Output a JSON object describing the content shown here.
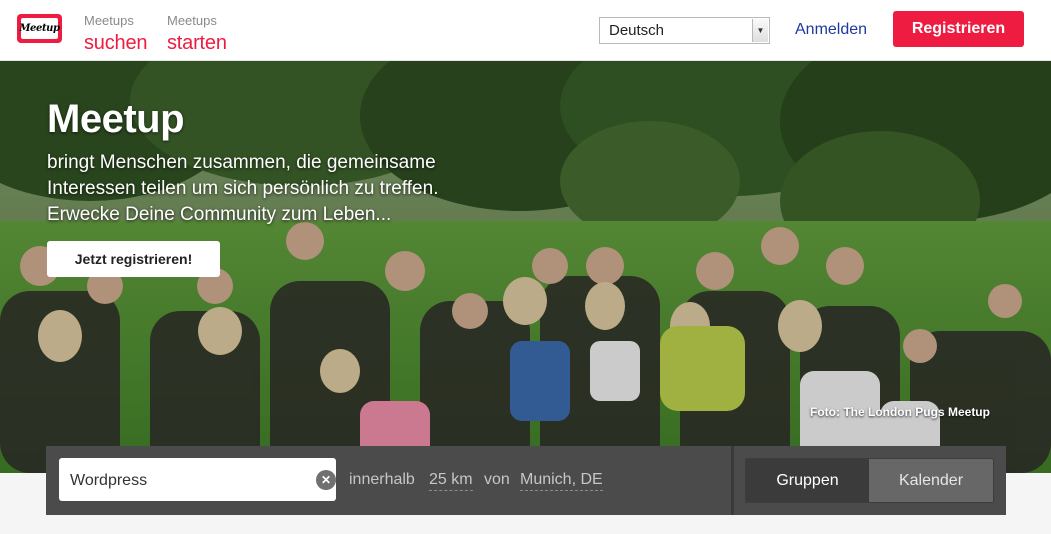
{
  "header": {
    "logo_text": "Meetup",
    "nav": [
      {
        "small": "Meetups",
        "big": "suchen"
      },
      {
        "small": "Meetups",
        "big": "starten"
      }
    ],
    "language": "Deutsch",
    "signin": "Anmelden",
    "register": "Registrieren"
  },
  "hero": {
    "title": "Meetup",
    "tagline": "bringt Menschen zusammen, die gemeinsame Interessen teilen um sich persönlich zu treffen. Erwecke Deine Community zum Leben...",
    "cta": "Jetzt registrieren!",
    "photo_credit": "Foto: The London Pugs Meetup"
  },
  "search": {
    "query": "Wordpress",
    "within_label": "innerhalb",
    "radius": "25 km",
    "from_label": "von",
    "location": "Munich, DE",
    "tabs": [
      "Gruppen",
      "Kalender"
    ],
    "active_tab": "Gruppen"
  },
  "colors": {
    "brand": "#ed1c40",
    "link": "#1e3a9e",
    "search_bar": "#4b4b4b"
  }
}
